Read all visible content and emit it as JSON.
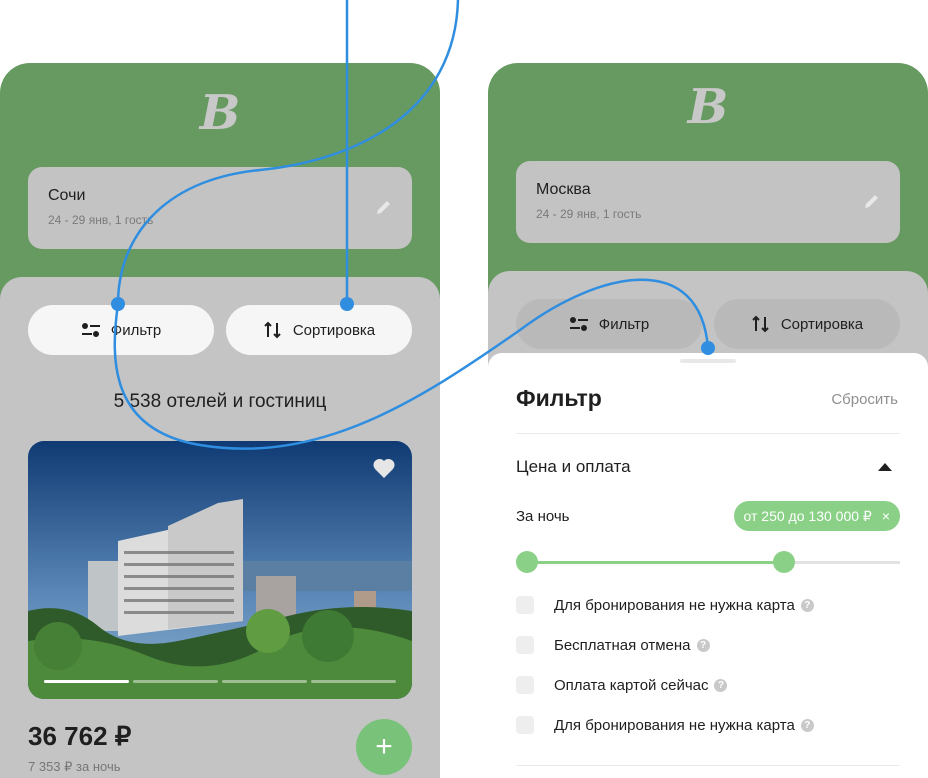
{
  "left_screen": {
    "search": {
      "city": "Сочи",
      "dates": "24 - 29 янв, 1 гость"
    },
    "filter_label": "Фильтр",
    "sort_label": "Сортировка",
    "results_count": "5 538 отелей и гостиниц",
    "gallery_page": 1,
    "gallery_pages": 4,
    "card": {
      "price": "36 762 ₽",
      "price_per_night": "7 353 ₽ за ночь",
      "add_icon": "plus-icon",
      "favorite_icon": "heart-icon"
    }
  },
  "right_screen": {
    "search": {
      "city": "Москва",
      "dates": "24 - 29 янв, 1 гость"
    },
    "filter_label": "Фильтр",
    "sort_label": "Сортировка",
    "panel": {
      "title": "Фильтр",
      "reset": "Сбросить",
      "section_title": "Цена и оплата",
      "per_night_label": "За ночь",
      "price_chip": "от 250  до 130 000 ₽",
      "chip_close": "×",
      "slider_range": [
        0,
        0.67
      ],
      "options": [
        {
          "label": "Для бронирования не нужна карта",
          "checked": false
        },
        {
          "label": "Бесплатная отмена",
          "checked": false
        },
        {
          "label": "Оплата картой сейчас",
          "checked": false
        },
        {
          "label": "Для бронирования не нужна карта",
          "checked": false
        }
      ]
    }
  },
  "colors": {
    "brand_green": "#679a60",
    "accent_green": "#8ad086",
    "annotation_blue": "#2f8ee0"
  }
}
